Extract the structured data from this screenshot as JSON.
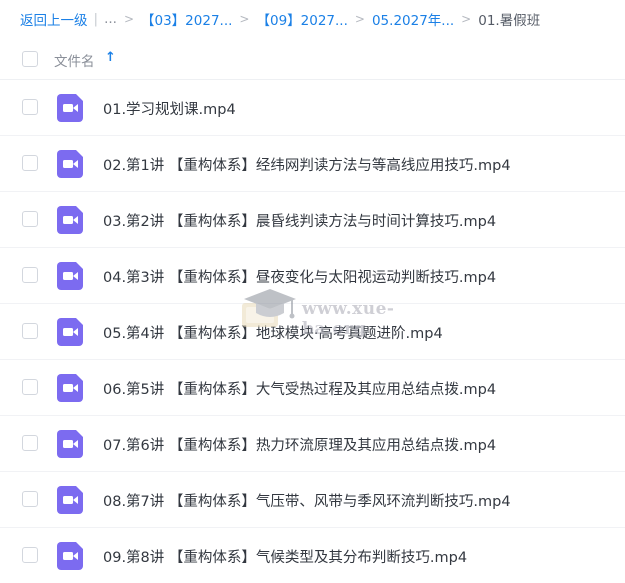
{
  "breadcrumb": {
    "back": "返回上一级",
    "dots": "...",
    "items": [
      "【03】2027...",
      "【09】2027...",
      "05.2027年..."
    ],
    "current": "01.暑假班"
  },
  "header": {
    "column_name": "文件名",
    "sort_icon": "↑"
  },
  "files": [
    "01.学习规划课.mp4",
    "02.第1讲 【重构体系】经纬网判读方法与等高线应用技巧.mp4",
    "03.第2讲 【重构体系】晨昏线判读方法与时间计算技巧.mp4",
    "04.第3讲 【重构体系】昼夜变化与太阳视运动判断技巧.mp4",
    "05.第4讲 【重构体系】地球模块·高考真题进阶.mp4",
    "06.第5讲 【重构体系】大气受热过程及其应用总结点拨.mp4",
    "07.第6讲 【重构体系】热力环流原理及其应用总结点拨.mp4",
    "08.第7讲 【重构体系】气压带、风带与季风环流判断技巧.mp4",
    "09.第8讲 【重构体系】气候类型及其分布判断技巧.mp4"
  ],
  "icons": {
    "file": "video-file-icon",
    "file_color": "#7c6bf0",
    "accent": "#1b80e6"
  },
  "watermark": {
    "text": "www.xue-ba.org"
  }
}
